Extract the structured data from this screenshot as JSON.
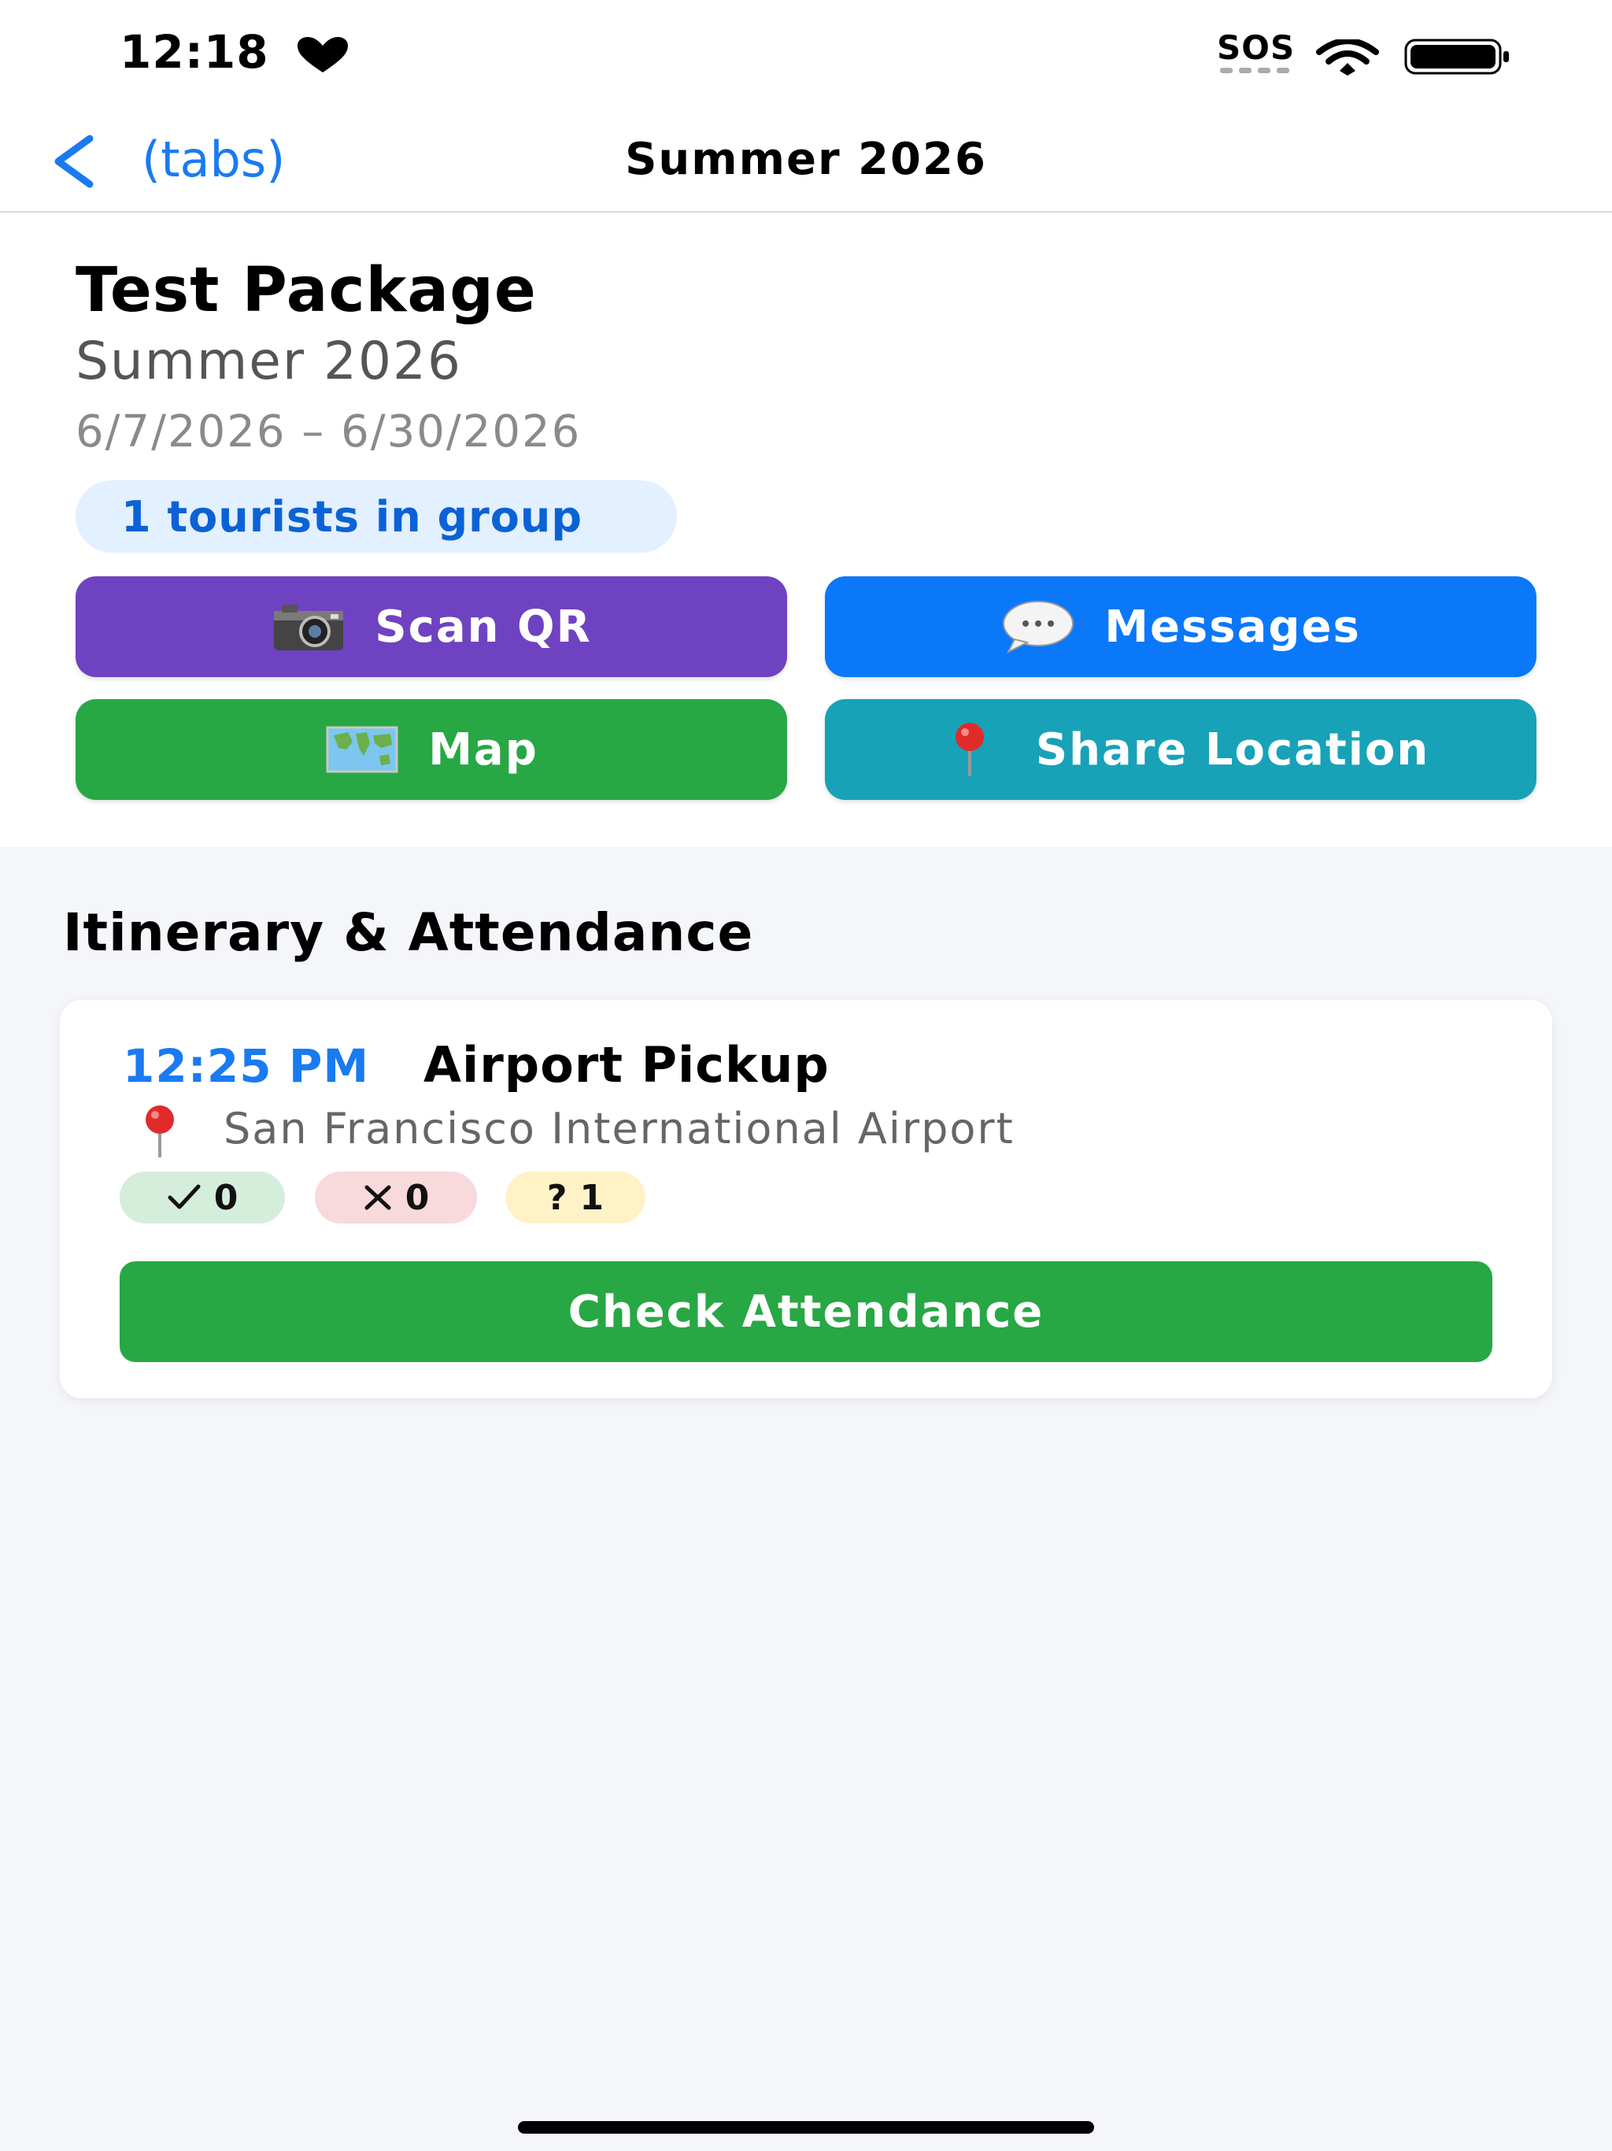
{
  "status_bar": {
    "time": "12:18",
    "carrier": "SOS"
  },
  "nav": {
    "back_label": "(tabs)",
    "title": "Summer 2026"
  },
  "package": {
    "title": "Test Package",
    "season": "Summer 2026",
    "dates": "6/7/2026 – 6/30/2026",
    "group_count": "1 tourists in group"
  },
  "actions": {
    "scan_qr": "Scan QR",
    "messages": "Messages",
    "map": "Map",
    "share_location": "Share Location"
  },
  "itinerary": {
    "section_title": "Itinerary & Attendance",
    "events": [
      {
        "time": "12:25 PM",
        "name": "Airport Pickup",
        "location": "San Francisco International Airport",
        "present_count": "0",
        "absent_count": "0",
        "unknown_count": "1",
        "check_label": "Check Attendance"
      }
    ]
  },
  "colors": {
    "accent_blue": "#1a7af2",
    "scan_purple": "#6f42c1",
    "messages_blue": "#0a78f9",
    "map_green": "#28a745",
    "share_teal": "#17a2b8"
  },
  "icons": [
    "heart-icon",
    "wifi-icon",
    "battery-icon",
    "back-chevron-icon",
    "camera-icon",
    "speech-bubble-icon",
    "world-map-icon",
    "round-pushpin-icon",
    "checkmark-icon",
    "cross-icon",
    "question-icon"
  ]
}
